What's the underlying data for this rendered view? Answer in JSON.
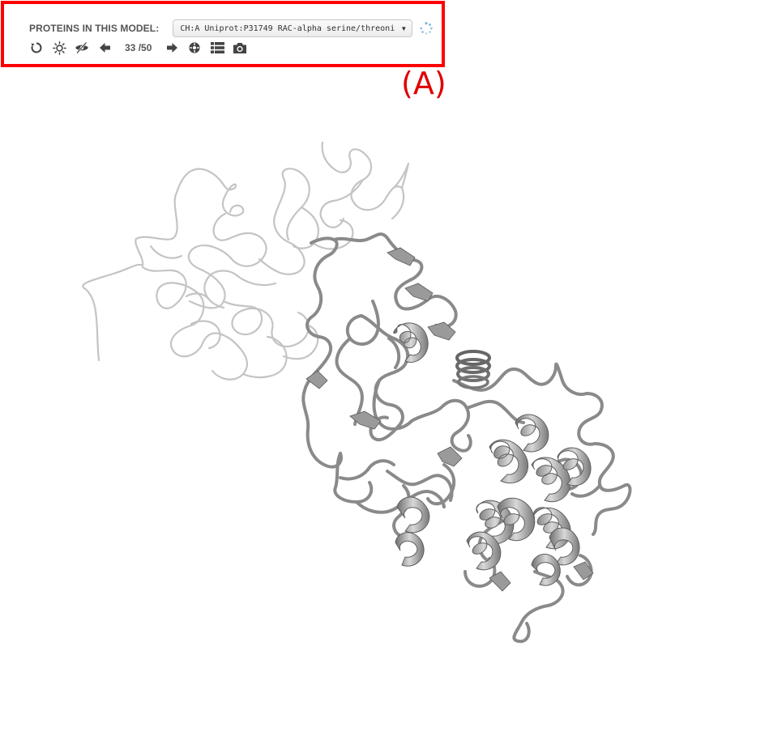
{
  "toolbar": {
    "proteins_label": "PROTEINS IN THIS MODEL:",
    "protein_select": {
      "selected": "CH:A Uniprot:P31749 RAC-alpha serine/threoni"
    },
    "model_current": "33",
    "model_total": "/50",
    "icons": [
      "reset-view-icon",
      "lighting-icon",
      "hide-icon",
      "previous-model-icon",
      "next-model-icon",
      "center-icon",
      "list-view-icon",
      "camera-icon"
    ]
  },
  "annotation": {
    "label": "(A)",
    "color": "#ff0000"
  },
  "colors": {
    "ribbon": "#8c8c8c",
    "ribbon_light": "#c4c4c4",
    "toolbar_text": "#555555"
  }
}
